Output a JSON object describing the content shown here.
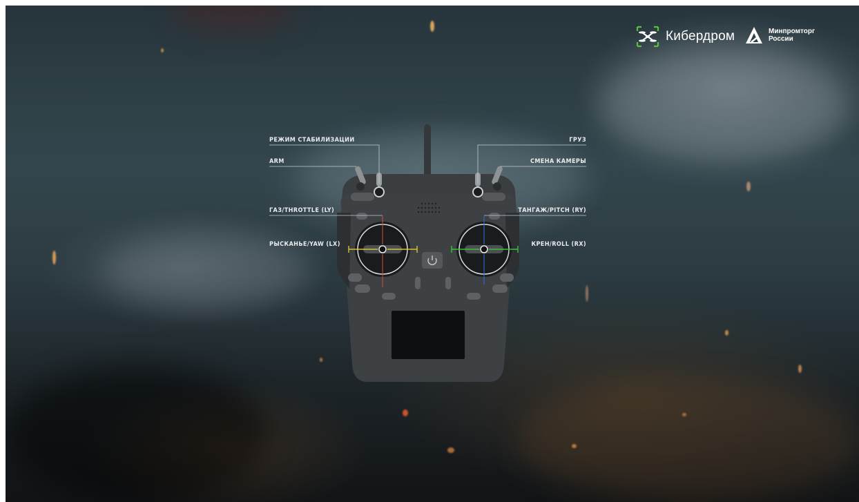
{
  "branding": {
    "kiberdrom": {
      "name": "Кибердром",
      "icon": "drone-icon",
      "accent": "#5bbf3a"
    },
    "minpromtorg": {
      "line1": "Минпромторг",
      "line2": "России",
      "icon": "triangle-logo-icon"
    }
  },
  "controls": {
    "stabilization_mode": "РЕЖИМ СТАБИЛИЗАЦИИ",
    "arm": "ARM",
    "throttle": "ГАЗ/THROTTLE (LY)",
    "yaw": "РЫСКАНЬЕ/YAW (LX)",
    "payload": "ГРУЗ",
    "camera_switch": "СМЕНА КАМЕРЫ",
    "pitch": "ТАНГАЖ/PITCH (RY)",
    "roll": "КРЕН/ROLL (RX)"
  },
  "axis_colors": {
    "throttle": "#d84a3c",
    "yaw": "#d9c232",
    "pitch": "#2f6ee0",
    "roll": "#3fbf3a"
  },
  "power_icon": "power-icon"
}
